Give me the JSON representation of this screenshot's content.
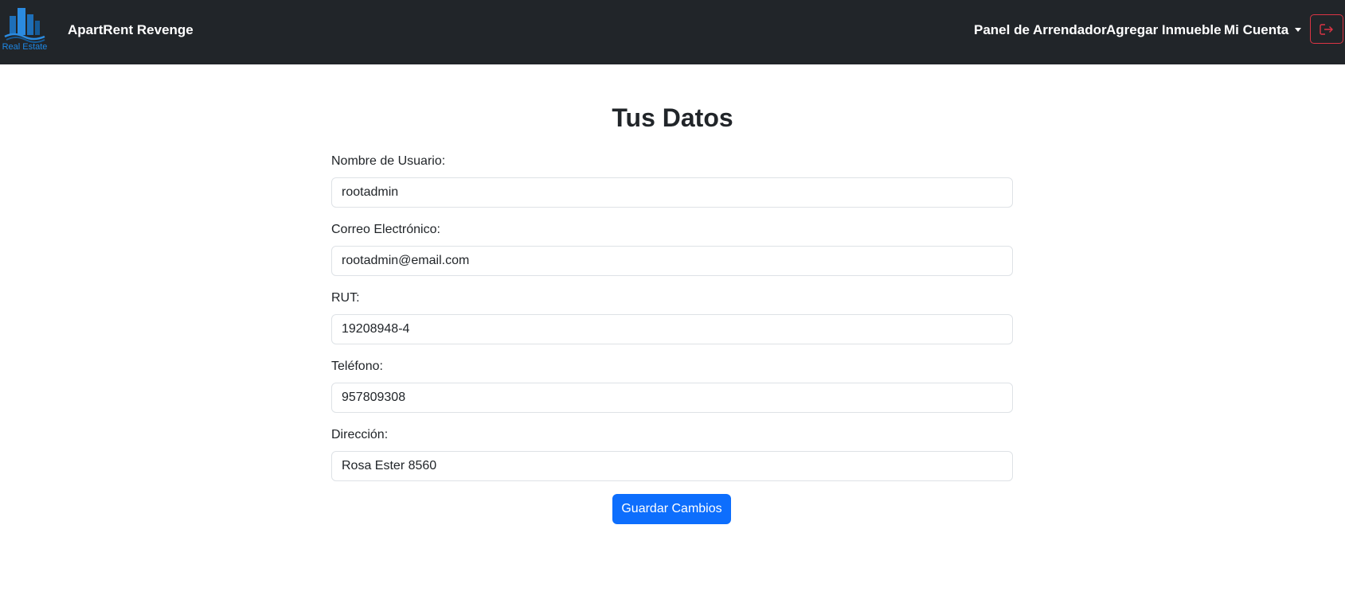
{
  "navbar": {
    "logo_text": "Real Estate",
    "brand": "ApartRent Revenge",
    "links": {
      "panel": "Panel de Arrendador",
      "add_property": "Agregar Inmueble",
      "account": "Mi Cuenta"
    },
    "logout_icon": "logout-icon",
    "logout_color": "#dc3545"
  },
  "page": {
    "title": "Tus Datos"
  },
  "form": {
    "username_label": "Nombre de Usuario:",
    "username_value": "rootadmin",
    "email_label": "Correo Electrónico:",
    "email_value": "rootadmin@email.com",
    "rut_label": "RUT:",
    "rut_value": "19208948-4",
    "phone_label": "Teléfono:",
    "phone_value": "957809308",
    "address_label": "Dirección:",
    "address_value": "Rosa Ester 8560",
    "save_label": "Guardar Cambios"
  },
  "colors": {
    "navbar_bg": "#212529",
    "primary": "#0d6efd",
    "danger": "#dc3545",
    "logo_blue": "#1e88e5"
  }
}
